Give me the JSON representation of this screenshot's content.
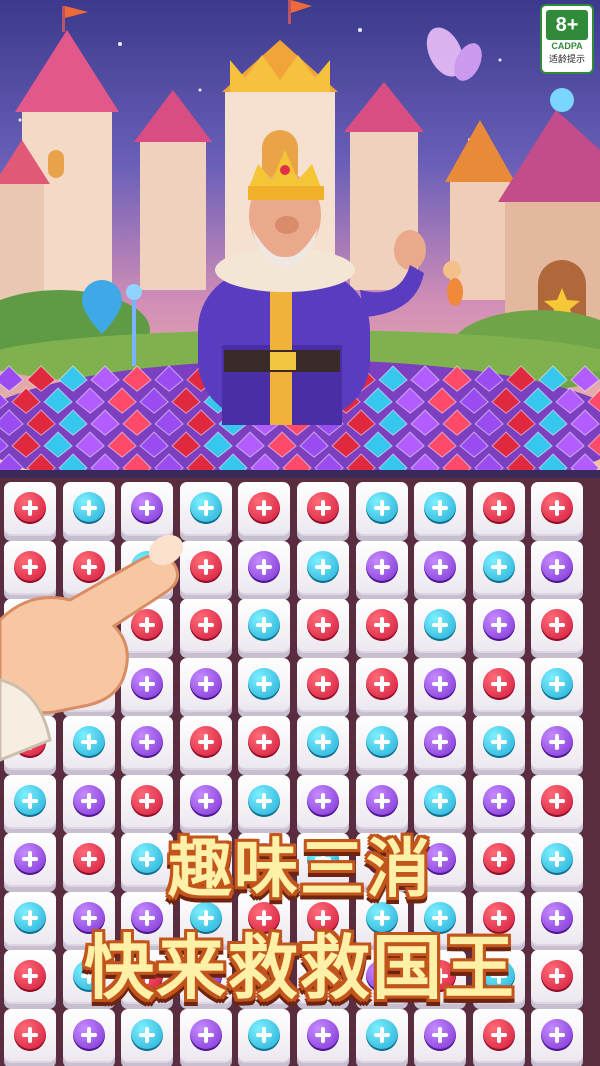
{
  "rating": {
    "age": "8+",
    "org": "CADPA",
    "tip": "适龄提示"
  },
  "headline": {
    "line1": "趣味三消",
    "line2": "快来救救国王"
  },
  "board": {
    "rows": [
      [
        "red",
        "cyan",
        "purple",
        "cyan",
        "red",
        "red",
        "cyan",
        "cyan",
        "red",
        "red"
      ],
      [
        "red",
        "red",
        "cyan",
        "red",
        "purple",
        "cyan",
        "purple",
        "purple",
        "cyan",
        "purple"
      ],
      [
        "purple",
        "red",
        "red",
        "red",
        "cyan",
        "red",
        "red",
        "cyan",
        "purple",
        "red"
      ],
      [
        "cyan",
        "purple",
        "purple",
        "purple",
        "cyan",
        "red",
        "red",
        "purple",
        "red",
        "cyan"
      ],
      [
        "red",
        "cyan",
        "purple",
        "red",
        "red",
        "cyan",
        "cyan",
        "purple",
        "cyan",
        "purple"
      ],
      [
        "cyan",
        "purple",
        "red",
        "purple",
        "cyan",
        "purple",
        "purple",
        "cyan",
        "purple",
        "red"
      ],
      [
        "purple",
        "red",
        "cyan",
        "red",
        "purple",
        "cyan",
        "purple",
        "purple",
        "red",
        "cyan"
      ],
      [
        "cyan",
        "purple",
        "purple",
        "cyan",
        "red",
        "red",
        "cyan",
        "cyan",
        "red",
        "purple"
      ],
      [
        "red",
        "cyan",
        "red",
        "purple",
        "cyan",
        "red",
        "purple",
        "red",
        "cyan",
        "red"
      ],
      [
        "red",
        "purple",
        "cyan",
        "purple",
        "cyan",
        "purple",
        "cyan",
        "purple",
        "red",
        "purple"
      ]
    ]
  },
  "colors": {
    "red": "#d0173a",
    "cyan": "#1fa9d4",
    "purple": "#7a2fd0",
    "board_bg": "#5a2c40"
  }
}
